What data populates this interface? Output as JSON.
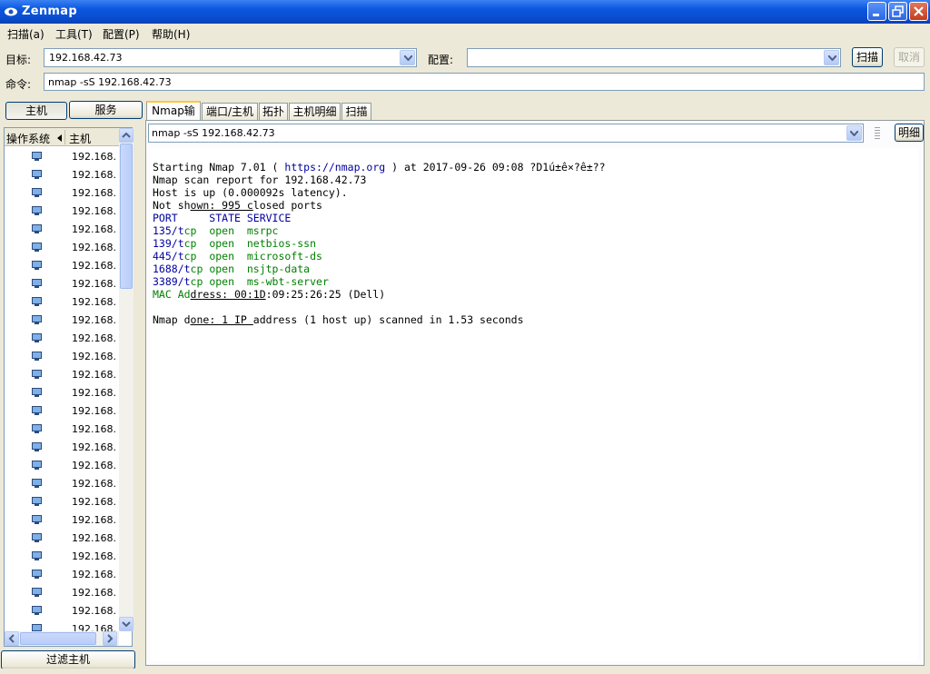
{
  "window": {
    "title": "Zenmap",
    "icon": "zenmap-eye-icon"
  },
  "menu": {
    "items": [
      "扫描(a)",
      "工具(T)",
      "配置(P)",
      "帮助(H)"
    ]
  },
  "toolbar": {
    "target_label": "目标:",
    "target_value": "192.168.42.73",
    "profile_label": "配置:",
    "profile_value": "",
    "scan_button": "扫描",
    "cancel_button": "取消",
    "command_label": "命令:",
    "command_value": "nmap -sS 192.168.42.73"
  },
  "left": {
    "hosts_button": "主机",
    "services_button": "服务",
    "col_os": "操作系统",
    "col_host": "主机",
    "host_ip_truncated": "192.168.",
    "host_count_visible": 27,
    "filter_button": "过滤主机"
  },
  "tabs": [
    "Nmap输出",
    "端口/主机",
    "拓扑",
    "主机明细",
    "扫描"
  ],
  "output": {
    "selected_command": "nmap -sS 192.168.42.73",
    "details_button": "明细",
    "lines": {
      "l1a": "Starting Nmap 7.01 ( ",
      "l1url": "https://nmap.org",
      "l1b": " ) at 2017-09-26 09:08 ?D1ú±ê×?ê±??",
      "l2": "Nmap scan report for 192.168.42.73",
      "l3": "Host is up (0.000092s latency).",
      "l4a": "Not sh",
      "l4u": "own: 995 c",
      "l4b": "losed ports",
      "l5": "PORT     STATE SERVICE",
      "p1port": "135/t",
      "p1rest": "cp  open  msrpc",
      "p2port": "139/t",
      "p2rest": "cp  open  netbios-ssn",
      "p3port": "445/t",
      "p3rest": "cp  open  microsoft-ds",
      "p4port": "1688/t",
      "p4rest": "cp open  nsjtp-data",
      "p5port": "3389/t",
      "p5rest": "cp open  ms-wbt-server",
      "maca": "MAC Ad",
      "macu": "dress: 00:1D",
      "macb": ":09:25:26:25 (Dell)",
      "donea": "Nmap d",
      "doneu": "one: 1 IP ",
      "doneb": "address (1 host up) scanned in 1.53 seconds"
    }
  },
  "colors": {
    "title_bar": "#0a56dd",
    "port_green": "#008000",
    "header_blue": "#0000a0"
  }
}
